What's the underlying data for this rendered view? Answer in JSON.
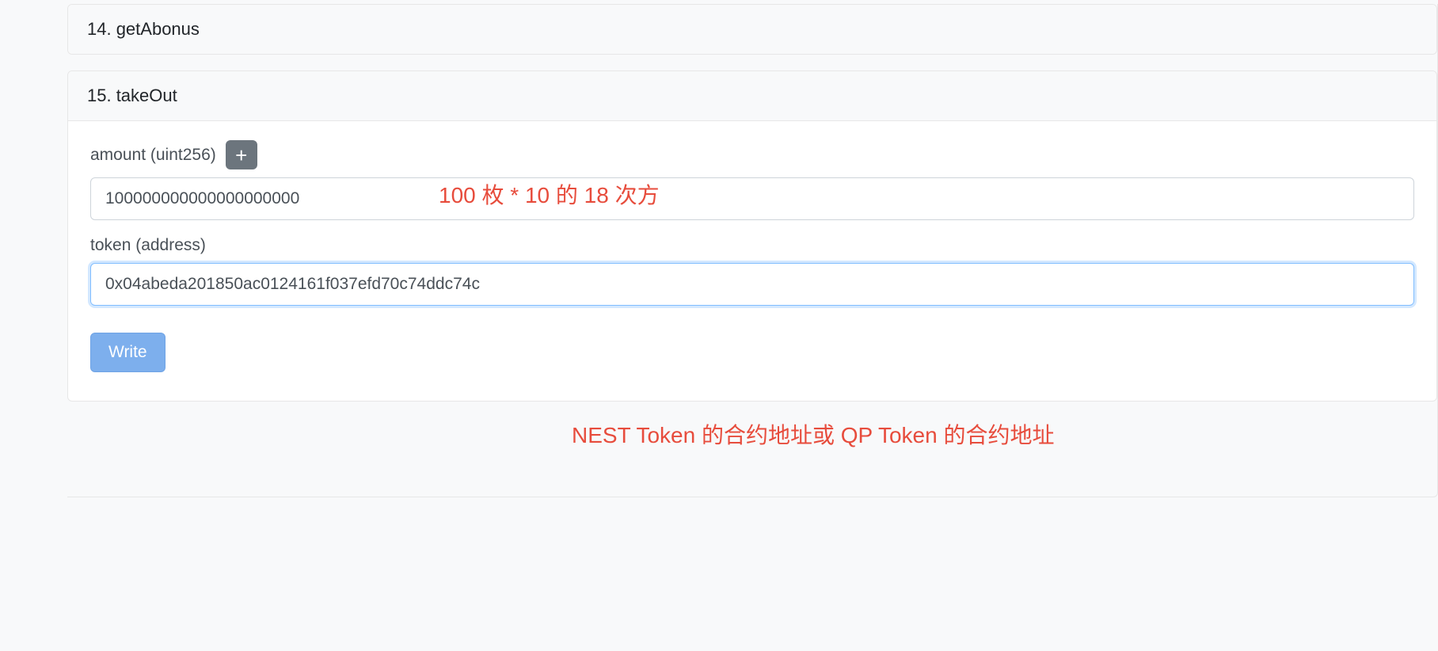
{
  "functions": [
    {
      "number": "14",
      "name": "getAbonus",
      "header": "14. getAbonus"
    },
    {
      "number": "15",
      "name": "takeOut",
      "header": "15. takeOut",
      "expanded": true,
      "fields": [
        {
          "label": "amount (uint256)",
          "value": "100000000000000000000",
          "hasPlusButton": true,
          "annotation": "100 枚 * 10 的 18 次方"
        },
        {
          "label": "token (address)",
          "value": "0x04abeda201850ac0124161f037efd70c74ddc74c",
          "hasPlusButton": false,
          "focused": true,
          "annotation": "NEST Token 的合约地址或 QP Token 的合约地址"
        }
      ],
      "submitLabel": "Write"
    }
  ]
}
